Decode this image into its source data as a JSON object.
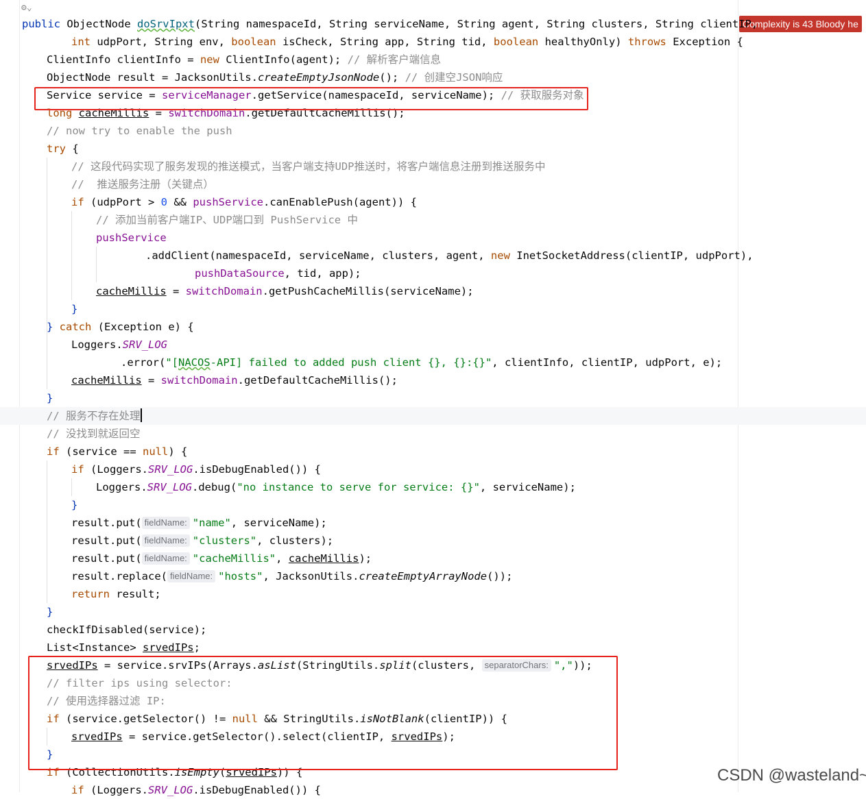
{
  "badge": {
    "text": "Complexity is 43 Bloody he"
  },
  "watermark": {
    "text": "CSDN @wasteland~"
  },
  "hints": {
    "fieldName": "fieldName:",
    "separatorChars": "separatorChars:"
  },
  "code": {
    "l1": {
      "t1": "public ",
      "t2": "ObjectNode ",
      "t3": "doSrvIpxt",
      "t4": "(String namespaceId, String serviceName, String agent, String clusters, String clientIP,"
    },
    "l2": {
      "t1": "int ",
      "t2": "udpPort, String env, ",
      "t3": "boolean ",
      "t4": "isCheck, String app, String tid, ",
      "t5": "boolean ",
      "t6": "healthyOnly) ",
      "t7": "throws ",
      "t8": "Exception {"
    },
    "l3": {
      "t1": "ClientInfo clientInfo = ",
      "t2": "new ",
      "t3": "ClientInfo(agent); ",
      "t4": "// 解析客户端信息"
    },
    "l4": {
      "t1": "ObjectNode result = JacksonUtils.",
      "t2": "createEmptyJsonNode",
      "t3": "(); ",
      "t4": "// 创建空JSON响应"
    },
    "l5": {
      "t1": "Service service = ",
      "t2": "serviceManager",
      "t3": ".getService(namespaceId, serviceName); ",
      "t4": "// 获取服务对象"
    },
    "l6": {
      "t1": "long ",
      "t2": "cacheMillis",
      "t3": " = ",
      "t4": "switchDomain",
      "t5": ".getDefaultCacheMillis();"
    },
    "l7": {
      "t1": "// now try to enable the push"
    },
    "l8": {
      "t1": "try ",
      "t2": "{"
    },
    "l9": {
      "t1": "// 这段代码实现了服务发现的推送模式，当客户端支持UDP推送时，将客户端信息注册到推送服务中"
    },
    "l10": {
      "t1": "//  推送服务注册（关键点）"
    },
    "l11": {
      "t1": "if ",
      "t2": "(udpPort > ",
      "t3": "0",
      "t4": " && ",
      "t5": "pushService",
      "t6": ".canEnablePush(agent)) {"
    },
    "l12": {
      "t1": "// 添加当前客户端IP、UDP端口到 PushService 中"
    },
    "l13": {
      "t1": "pushService"
    },
    "l14": {
      "t1": ".addClient(namespaceId, serviceName, clusters, agent, ",
      "t2": "new ",
      "t3": "InetSocketAddress(clientIP, udpPort),"
    },
    "l15": {
      "t1": "pushDataSource",
      "t2": ", tid, app);"
    },
    "l16": {
      "t1": "cacheMillis",
      "t2": " = ",
      "t3": "switchDomain",
      "t4": ".getPushCacheMillis(serviceName);"
    },
    "l17": {
      "t1": "}"
    },
    "l18": {
      "t1": "} ",
      "t2": "catch ",
      "t3": "(Exception e) {"
    },
    "l19": {
      "t1": "Loggers.",
      "t2": "SRV_LOG"
    },
    "l20": {
      "t1": ".error(",
      "t2": "\"[",
      "t3": "NACOS",
      "t4": "-API] failed to added push client {}, {}:{}\"",
      "t5": ", clientInfo, clientIP, udpPort, e);"
    },
    "l21": {
      "t1": "cacheMillis",
      "t2": " = ",
      "t3": "switchDomain",
      "t4": ".getDefaultCacheMillis();"
    },
    "l22": {
      "t1": "}"
    },
    "l23": {
      "t1": "// 服务不存在处理"
    },
    "l24": {
      "t1": "// 没找到就返回空"
    },
    "l25": {
      "t1": "if ",
      "t2": "(service == ",
      "t3": "null",
      "t4": ") {"
    },
    "l26": {
      "t1": "if ",
      "t2": "(Loggers.",
      "t3": "SRV_LOG",
      "t4": ".isDebugEnabled()) {"
    },
    "l27": {
      "t1": "Loggers.",
      "t2": "SRV_LOG",
      "t3": ".debug(",
      "t4": "\"no instance to serve for service: {}\"",
      "t5": ", serviceName);"
    },
    "l28": {
      "t1": "}"
    },
    "l29": {
      "t1": "result.put(",
      "t2": "\"name\"",
      "t3": ", serviceName);"
    },
    "l30": {
      "t1": "result.put(",
      "t2": "\"clusters\"",
      "t3": ", clusters);"
    },
    "l31": {
      "t1": "result.put(",
      "t2": "\"cacheMillis\"",
      "t3": ", ",
      "t4": "cacheMillis",
      "t5": ");"
    },
    "l32": {
      "t1": "result.replace(",
      "t2": "\"hosts\"",
      "t3": ", JacksonUtils.",
      "t4": "createEmptyArrayNode",
      "t5": "());"
    },
    "l33": {
      "t1": "return ",
      "t2": "result;"
    },
    "l34": {
      "t1": "}"
    },
    "l35": {
      "t1": "checkIfDisabled(service);"
    },
    "l36": {
      "t1": "List<Instance> ",
      "t2": "srvedIPs",
      "t3": ";"
    },
    "l37": {
      "t1": "srvedIPs",
      "t2": " = service.srvIPs(Arrays.",
      "t3": "asList",
      "t4": "(StringUtils.",
      "t5": "split",
      "t6": "(clusters, ",
      "t7": "\",\"",
      "t8": "));"
    },
    "l38": {
      "t1": "// filter ips using selector:"
    },
    "l39": {
      "t1": "// 使用选择器过滤 IP:"
    },
    "l40": {
      "t1": "if ",
      "t2": "(service.getSelector() != ",
      "t3": "null",
      "t4": " && StringUtils.",
      "t5": "isNotBlank",
      "t6": "(clientIP)) {"
    },
    "l41": {
      "t1": "srvedIPs",
      "t2": " = service.getSelector().select(clientIP, ",
      "t3": "srvedIPs",
      "t4": ");"
    },
    "l42": {
      "t1": "}"
    },
    "l43": {
      "t1": "if ",
      "t2": "(CollectionUtils.",
      "t3": "isEmpty",
      "t4": "(",
      "t5": "srvedIPs",
      "t6": ")) {"
    },
    "l44": {
      "t1": "if ",
      "t2": "(Loggers.",
      "t3": "SRV_LOG",
      "t4": ".isDebugEnabled()) {"
    }
  }
}
